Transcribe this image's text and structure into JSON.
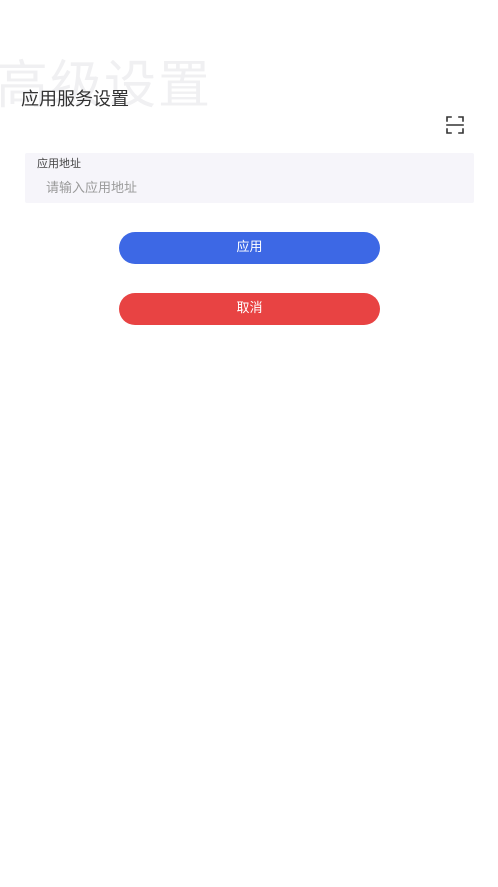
{
  "watermark_text": "高级设置",
  "page_title": "应用服务设置",
  "scan_icon": "scan-icon",
  "app_address": {
    "label": "应用地址",
    "value": "",
    "placeholder": "请输入应用地址"
  },
  "buttons": {
    "apply_label": "应用",
    "cancel_label": "取消"
  },
  "colors": {
    "apply": "#3d68e5",
    "cancel": "#e84343",
    "field_background": "#f6f5fa",
    "title": "#333333",
    "watermark": "#f0f0f2"
  }
}
